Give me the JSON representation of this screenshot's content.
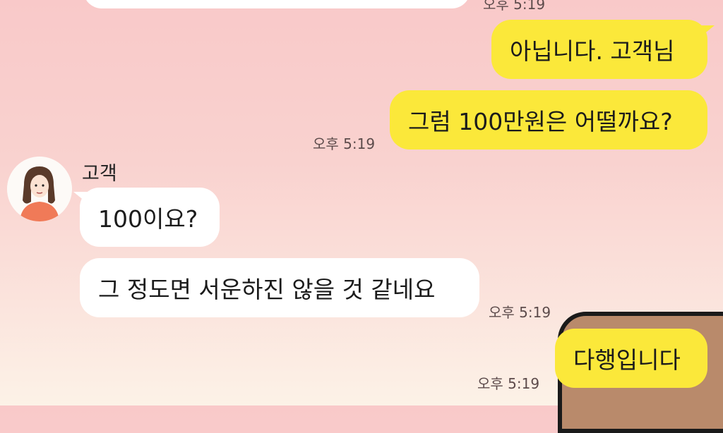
{
  "messages": {
    "top_time": "오후 5:19",
    "m1": "아닙니다. 고객님",
    "m2": "그럼 100만원은 어떨까요?",
    "m2_time": "오후 5:19",
    "sender": "고객",
    "r1": "100이요?",
    "r2": "그 정도면 서운하진 않을 것 같네요",
    "r2_time": "오후 5:19",
    "m3": "다행입니다",
    "m3_time": "오후 5:19"
  },
  "avatar": {
    "icon": "woman-avatar-icon"
  },
  "colors": {
    "mine_bubble": "#fbe83a",
    "theirs_bubble": "#ffffff",
    "background": "#f9c9c9"
  }
}
